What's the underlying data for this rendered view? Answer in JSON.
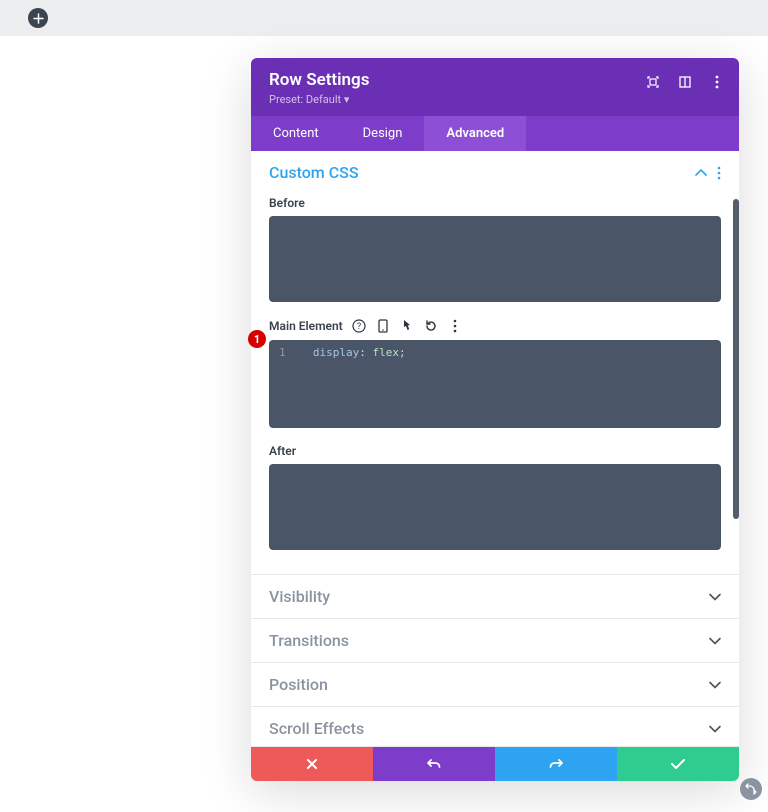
{
  "top": {
    "add_label": "+"
  },
  "modal": {
    "title": "Row Settings",
    "preset": "Preset: Default ▾"
  },
  "tabs": {
    "content": "Content",
    "design": "Design",
    "advanced": "Advanced"
  },
  "sections": {
    "custom_css": {
      "title": "Custom CSS",
      "before_label": "Before",
      "main_label": "Main Element",
      "after_label": "After",
      "code_line": "1",
      "code_prop": "display",
      "code_colon": ":",
      "code_val": "flex",
      "code_semi": ";"
    },
    "visibility": "Visibility",
    "transitions": "Transitions",
    "position": "Position",
    "scroll_effects": "Scroll Effects"
  },
  "badge": "1"
}
